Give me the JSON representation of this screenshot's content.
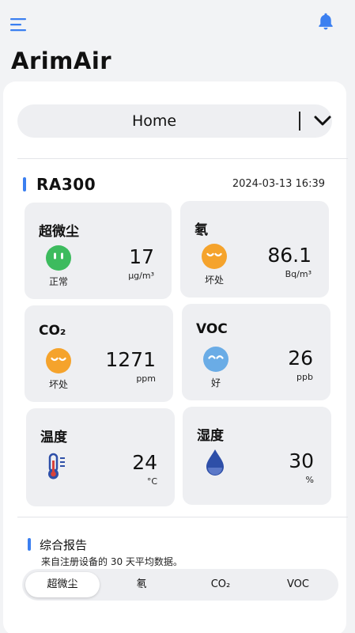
{
  "app": {
    "title": "ArimAir"
  },
  "selector": {
    "label": "Home"
  },
  "device": {
    "name": "RA300",
    "datetime": "2024-03-13 16:39"
  },
  "metrics": [
    {
      "label": "超微尘",
      "status": "正常",
      "value": "17",
      "unit": "μg/m³",
      "face": "good-face-icon",
      "face_color": "#3dbb5e"
    },
    {
      "label": "氡",
      "status": "坏处",
      "value": "86.1",
      "unit": "Bq/m³",
      "face": "bad-face-icon",
      "face_color": "#f5a32c"
    },
    {
      "label": "CO₂",
      "status": "坏处",
      "value": "1271",
      "unit": "ppm",
      "face": "bad-face-icon",
      "face_color": "#f5a32c"
    },
    {
      "label": "VOC",
      "status": "好",
      "value": "26",
      "unit": "ppb",
      "face": "good-face-icon",
      "face_color": "#6aace6"
    },
    {
      "label": "温度",
      "value": "24",
      "unit": "°C",
      "icon": "thermometer-icon",
      "icon_color": "#2e4fa8"
    },
    {
      "label": "湿度",
      "value": "30",
      "unit": "%",
      "icon": "water-drop-icon",
      "icon_color": "#2e4fa8"
    }
  ],
  "report": {
    "title": "综合报告",
    "subtitle": "来自注册设备的 30 天平均数据。",
    "tabs": [
      {
        "label": "超微尘",
        "active": true
      },
      {
        "label": "氡",
        "active": false
      },
      {
        "label": "CO₂",
        "active": false
      },
      {
        "label": "VOC",
        "active": false
      }
    ]
  },
  "colors": {
    "accent": "#3b7ff0",
    "good": "#3dbb5e",
    "warning": "#f5a32c",
    "excellent": "#6aace6"
  }
}
